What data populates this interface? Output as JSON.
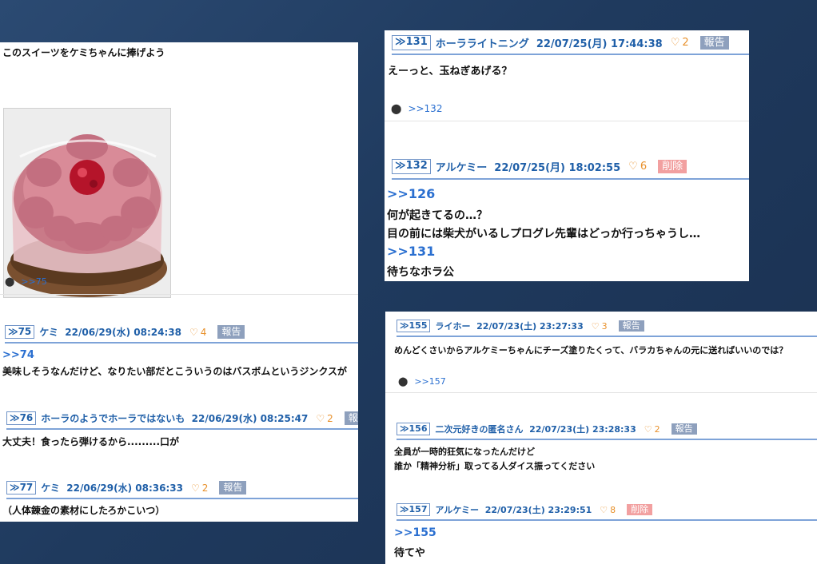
{
  "left": {
    "intro": "このスイーツをケミちゃんに捧げよう",
    "image_label": "cake",
    "reply": {
      "link": ">>75"
    },
    "posts": [
      {
        "num": "75",
        "name": "ケミ",
        "date": "22/06/29(水) 08:24:38",
        "likes": "4",
        "report": "報告",
        "anchor": ">>74",
        "text": "美味しそうなんだけど、なりたい部だとこういうのはバスボムというジンクスが"
      },
      {
        "num": "76",
        "name": "ホーラのようでホーラではないも",
        "date": "22/06/29(水) 08:25:47",
        "likes": "2",
        "report": "報告",
        "text": "大丈夫！食ったら弾けるから.........口が"
      },
      {
        "num": "77",
        "name": "ケミ",
        "date": "22/06/29(水) 08:36:33",
        "likes": "2",
        "report": "報告",
        "text": "（人体錬金の素材にしたろかこいつ）"
      }
    ]
  },
  "topright": {
    "post131": {
      "num": "131",
      "name": "ホーラライトニング",
      "date": "22/07/25(月) 17:44:38",
      "likes": "2",
      "report": "報告",
      "text": "えーっと、玉ねぎあげる？",
      "reply_link": ">>132"
    },
    "post132": {
      "num": "132",
      "name": "アルケミー",
      "date": "22/07/25(月) 18:02:55",
      "likes": "6",
      "delete": "削除",
      "anchor1": ">>126",
      "line1": "何が起きてるの…？",
      "line2": "目の前には柴犬がいるしプログレ先輩はどっか行っちゃうし…",
      "anchor2": ">>131",
      "line3": "待ちなホラ公"
    }
  },
  "bottomright": {
    "post155": {
      "num": "155",
      "name": "ライホー",
      "date": "22/07/23(土) 23:27:33",
      "likes": "3",
      "report": "報告",
      "text": "めんどくさいからアルケミーちゃんにチーズ塗りたくって、バラカちゃんの元に送ればいいのでは？",
      "reply_link": ">>157"
    },
    "post156": {
      "num": "156",
      "name": "二次元好きの匿名さん",
      "date": "22/07/23(土) 23:28:33",
      "likes": "2",
      "report": "報告",
      "line1": "全員が一時的狂気になったんだけど",
      "line2": "誰か「精神分析」取ってる人ダイス振ってください"
    },
    "post157": {
      "num": "157",
      "name": "アルケミー",
      "date": "22/07/23(土) 23:29:51",
      "likes": "8",
      "delete": "削除",
      "anchor": ">>155",
      "text": "待てや"
    }
  }
}
